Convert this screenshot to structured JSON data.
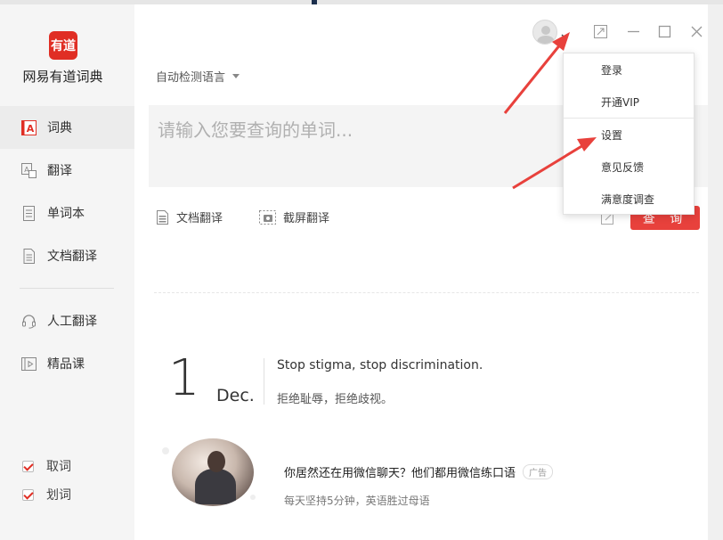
{
  "app": {
    "logo_text": "有道",
    "name": "网易有道词典"
  },
  "sidebar": {
    "items": [
      {
        "label": "词典",
        "icon": "dict-a-icon",
        "active": true
      },
      {
        "label": "翻译",
        "icon": "translate-icon",
        "active": false
      },
      {
        "label": "单词本",
        "icon": "wordbook-icon",
        "active": false
      },
      {
        "label": "文档翻译",
        "icon": "document-icon",
        "active": false
      },
      {
        "label": "人工翻译",
        "icon": "headset-icon",
        "active": false
      },
      {
        "label": "精品课",
        "icon": "course-play-icon",
        "active": false
      }
    ],
    "options": [
      {
        "label": "取词",
        "checked": true
      },
      {
        "label": "划词",
        "checked": true
      }
    ]
  },
  "main": {
    "language_select": "自动检测语言",
    "search_placeholder": "请输入您要查询的单词...",
    "tools": {
      "doc_translate": "文档翻译",
      "screenshot_translate": "截屏翻译"
    },
    "query_button": "查 询",
    "daily": {
      "day": "1",
      "month": "Dec.",
      "quote_en": "Stop stigma, stop discrimination.",
      "quote_cn": "拒绝耻辱，拒绝歧视。"
    },
    "ad": {
      "title": "你居然还在用微信聊天？他们都用微信练口语",
      "badge": "广告",
      "subtitle": "每天坚持5分钟，英语胜过母语"
    }
  },
  "user_menu": {
    "items": [
      "登录",
      "开通VIP",
      "设置",
      "意见反馈",
      "满意度调查"
    ]
  },
  "colors": {
    "brand_red": "#e02e24",
    "button_red": "#e8413c",
    "sidebar_bg": "#f5f5f5",
    "annotation_arrow": "#e8413c"
  }
}
